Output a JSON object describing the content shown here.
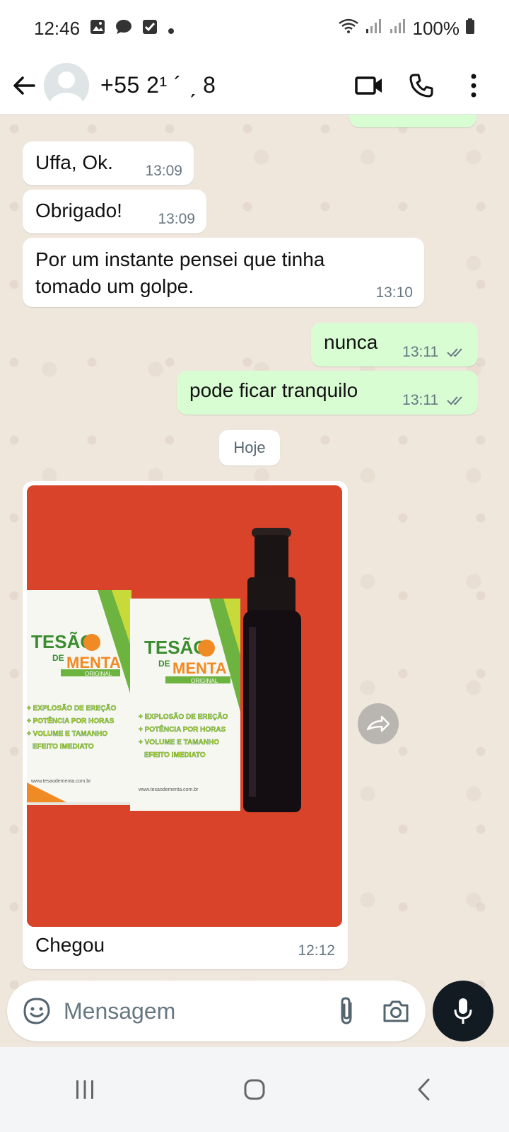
{
  "status_bar": {
    "time": "12:46",
    "battery": "100%",
    "icons": [
      "image-icon",
      "chat-icon",
      "checkbox-icon",
      "dot-icon",
      "wifi-icon",
      "signal-icon",
      "signal-icon",
      "battery-icon"
    ]
  },
  "header": {
    "contact": "+55 2¹ ´                    ˏ 8",
    "icons": [
      "back-arrow-icon",
      "avatar",
      "video-call-icon",
      "phone-icon",
      "more-vert-icon"
    ]
  },
  "messages": [
    {
      "text": "Uffa, Ok.",
      "time": "13:09",
      "direction": "in"
    },
    {
      "text": "Obrigado!",
      "time": "13:09",
      "direction": "in"
    },
    {
      "text": "Por um instante pensei que tinha tomado um golpe.",
      "time": "13:10",
      "direction": "in"
    },
    {
      "text": "nunca",
      "time": "13:11",
      "direction": "out",
      "status": "read"
    },
    {
      "text": "pode ficar tranquilo",
      "time": "13:11",
      "direction": "out",
      "status": "read"
    }
  ],
  "date_chip": "Hoje",
  "image_message": {
    "caption": "Chegou",
    "time": "12:12",
    "product": {
      "brand_line1": "TESÃO",
      "brand_line2": "DE",
      "brand_line3": "MENTA",
      "badge": "ORIGINAL",
      "features": [
        "+ EXPLOSÃO DE EREÇÃO",
        "+ POTÊNCIA POR HORAS",
        "+ VOLUME E TAMANHO",
        "EFEITO IMEDIATO"
      ],
      "website": "www.tesaodementa.com.br"
    }
  },
  "composer": {
    "placeholder": "Mensagem"
  },
  "colors": {
    "outgoing_bubble": "#d9fdd3",
    "incoming_bubble": "#ffffff",
    "chat_background": "#efe7dc",
    "read_ticks": "#53bdeb",
    "mic_button": "#111b21"
  }
}
